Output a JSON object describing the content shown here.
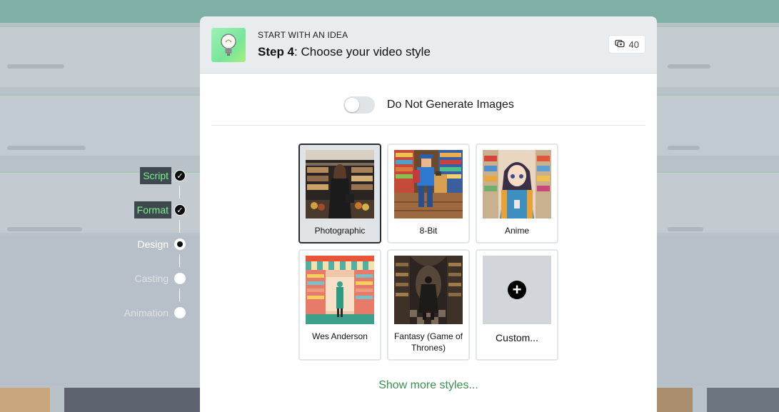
{
  "stepper": {
    "steps": [
      {
        "label": "Script",
        "state": "done"
      },
      {
        "label": "Format",
        "state": "done"
      },
      {
        "label": "Design",
        "state": "current"
      },
      {
        "label": "Casting",
        "state": "future"
      },
      {
        "label": "Animation",
        "state": "future"
      }
    ]
  },
  "modal": {
    "eyebrow": "START WITH AN IDEA",
    "step_bold": "Step 4",
    "step_rest": ": Choose your video style",
    "credits": "40",
    "toggle": {
      "label": "Do Not Generate Images",
      "on": false
    },
    "styles": [
      {
        "name": "Photographic",
        "selected": true
      },
      {
        "name": "8-Bit",
        "selected": false
      },
      {
        "name": "Anime",
        "selected": false
      },
      {
        "name": "Wes Anderson",
        "selected": false
      },
      {
        "name": "Fantasy (Game of Thrones)",
        "selected": false
      },
      {
        "name": "Custom...",
        "selected": false
      }
    ],
    "show_more": "Show more styles..."
  },
  "colors": {
    "accent_green": "#3d8f4f",
    "done_label_green": "#7ef08f",
    "selected_border": "#2a2f33"
  }
}
